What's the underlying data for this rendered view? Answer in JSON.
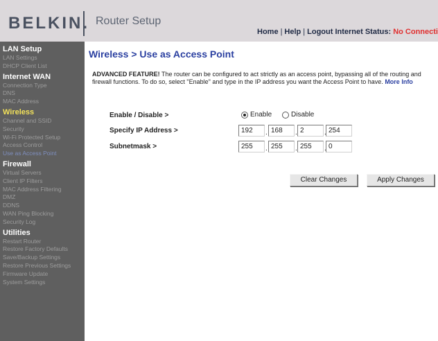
{
  "header": {
    "logo": "BELKIN.",
    "app_title": "Router Setup",
    "links": {
      "home": "Home",
      "help": "Help",
      "logout": "Logout",
      "sep": "|"
    },
    "status_label": "Internet Status:",
    "status_value": "No Connectio"
  },
  "sidebar": {
    "lan_setup": "LAN Setup",
    "lan_settings": "LAN Settings",
    "dhcp_client_list": "DHCP Client List",
    "internet_wan": "Internet WAN",
    "connection_type": "Connection Type",
    "dns": "DNS",
    "mac_address": "MAC Address",
    "wireless": "Wireless",
    "channel_ssid": "Channel and SSID",
    "security": "Security",
    "wps": "Wi-Fi Protected Setup",
    "access_control": "Access Control",
    "use_as_ap": "Use as Access Point",
    "firewall": "Firewall",
    "virtual_servers": "Virtual Servers",
    "client_ip_filters": "Client IP Filters",
    "mac_filtering": "MAC Address Filtering",
    "dmz": "DMZ",
    "ddns": "DDNS",
    "wan_ping": "WAN Ping Blocking",
    "security_log": "Security Log",
    "utilities": "Utilities",
    "restart_router": "Restart Router",
    "restore_factory": "Restore Factory Defaults",
    "save_backup": "Save/Backup Settings",
    "restore_previous": "Restore Previous Settings",
    "firmware_update": "Firmware Update",
    "system_settings": "System Settings"
  },
  "main": {
    "title": "Wireless > Use as Access Point",
    "desc_strong": "ADVANCED FEATURE!",
    "desc_text": " The router can be configured to act strictly as an access point, bypassing all of the routing and firewall functions. To do so, select \"Enable\" and type in the IP address you want the Access Point to have. ",
    "more_info": "More Info",
    "enable_label": "Enable / Disable >",
    "enable_option": "Enable",
    "disable_option": "Disable",
    "selected": "Enable",
    "ip_label": "Specify IP Address >",
    "ip": [
      "192",
      "168",
      "2",
      "254"
    ],
    "subnet_label": "Subnetmask >",
    "subnet": [
      "255",
      "255",
      "255",
      "0"
    ],
    "clear_button": "Clear Changes",
    "apply_button": "Apply Changes"
  }
}
